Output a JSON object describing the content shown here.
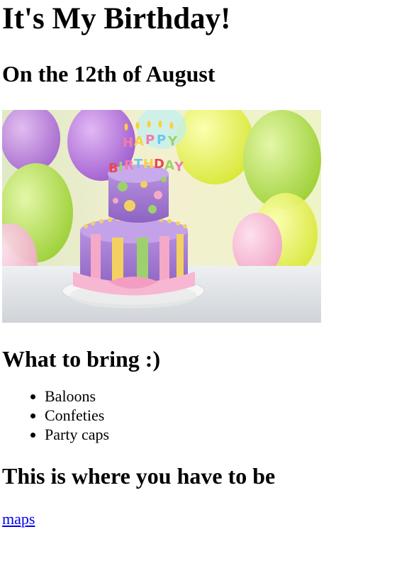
{
  "page": {
    "title": "It's My Birthday!",
    "date_heading": "On the 12th of August",
    "cake_image": {
      "icon": "birthday-cake-image",
      "topper_text": "HAPPY BIRTHDAY"
    },
    "bring_heading": "What to bring :)",
    "bring_items": [
      "Baloons",
      "Confeties",
      "Party caps"
    ],
    "location_heading": "This is where you have to be",
    "maps_link_label": "maps"
  },
  "colors": {
    "link": "#0000ee",
    "text": "#000000",
    "background": "#ffffff"
  }
}
